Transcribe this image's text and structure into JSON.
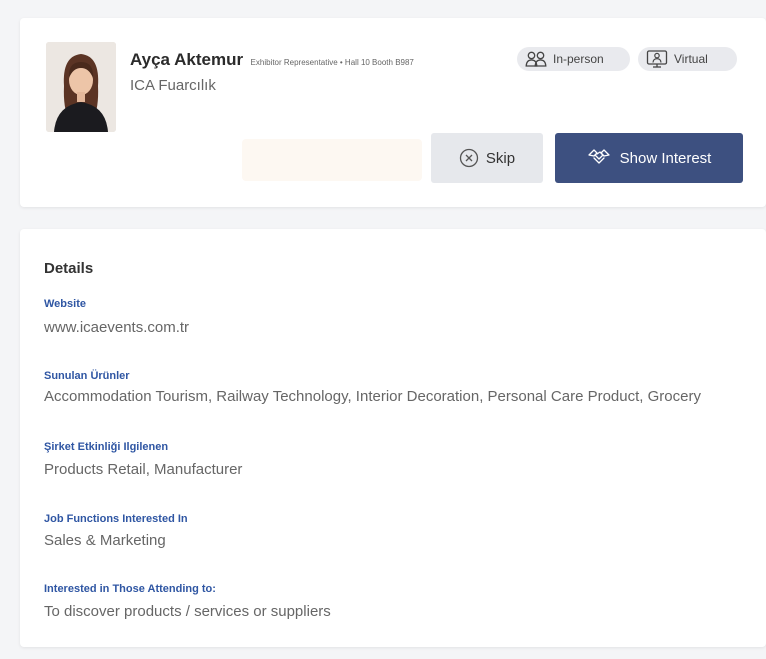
{
  "profile": {
    "name": "Ayça Aktemur",
    "role": "Exhibitor Representative • Hall 10 Booth B987",
    "company": "ICA Fuarcılık",
    "badges": {
      "in_person": "In-person",
      "virtual": "Virtual"
    },
    "actions": {
      "skip": "Skip",
      "show_interest": "Show Interest"
    }
  },
  "details": {
    "title": "Details",
    "fields": [
      {
        "label": "Website",
        "value": "www.icaevents.com.tr"
      },
      {
        "label": "Sunulan Ürünler",
        "value": "Accommodation Tourism, Railway Technology, Interior Decoration, Personal Care Product, Grocery"
      },
      {
        "label": "Şirket Etkinliği Ilgilenen",
        "value": "Products Retail, Manufacturer"
      },
      {
        "label": "Job Functions Interested In",
        "value": "Sales & Marketing"
      },
      {
        "label": "Interested in Those Attending to:",
        "value": "To discover products / services or suppliers"
      }
    ]
  },
  "colors": {
    "primary": "#3d5080",
    "label_blue": "#2f56a3",
    "pill_bg": "#e9eaee",
    "skip_bg": "#e6e8ec"
  },
  "icons": {
    "in_person": "two-people-icon",
    "virtual": "monitor-person-icon",
    "skip": "close-circle-icon",
    "show_interest": "handshake-icon"
  }
}
